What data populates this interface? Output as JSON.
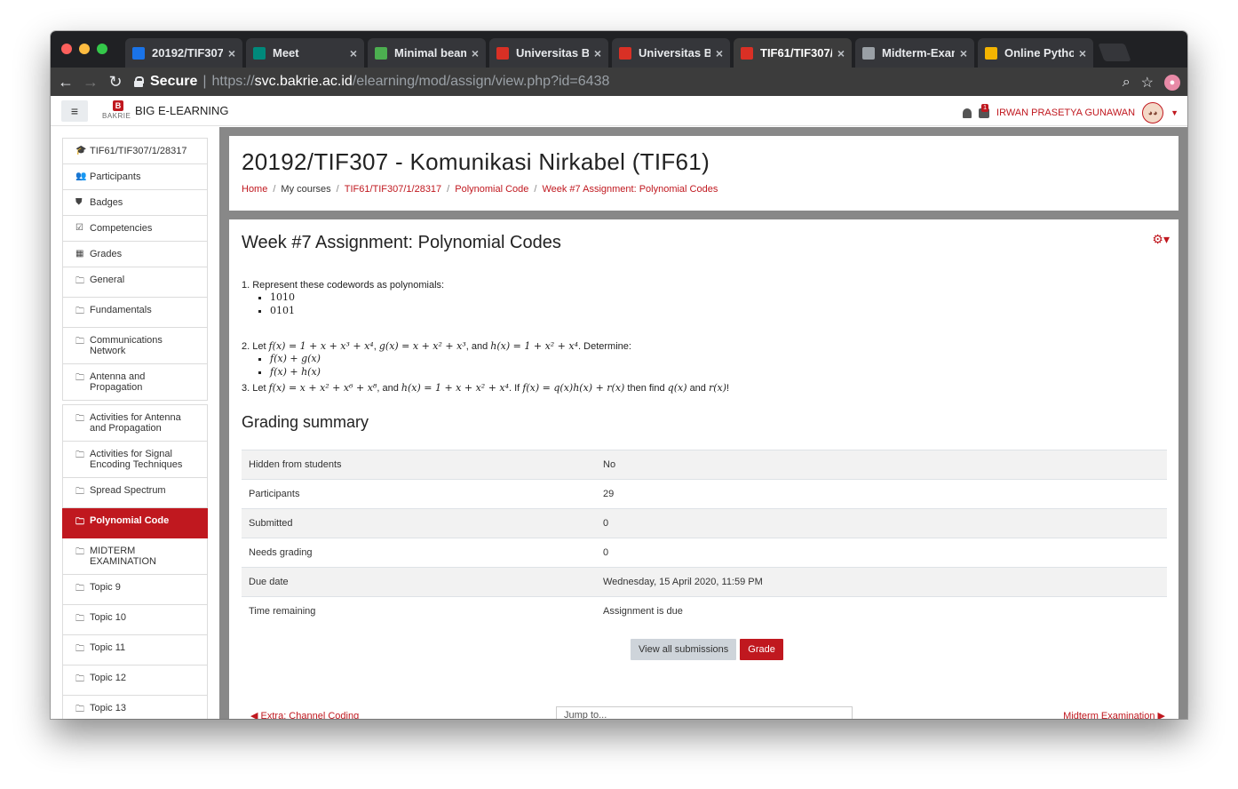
{
  "browser": {
    "tabs": [
      {
        "title": "20192/TIF307",
        "favicon": "moodle-icon",
        "color": "#1a73e8"
      },
      {
        "title": "Meet",
        "favicon": "meet-icon",
        "color": "#00897b"
      },
      {
        "title": "Minimal beam",
        "favicon": "overleaf-icon",
        "color": "#4caf50"
      },
      {
        "title": "Universitas Bak",
        "favicon": "bakrie-icon",
        "color": "#d93025"
      },
      {
        "title": "Universitas Bak",
        "favicon": "bakrie-icon",
        "color": "#d93025"
      },
      {
        "title": "TIF61/TIF307/",
        "favicon": "bakrie-icon",
        "color": "#d93025"
      },
      {
        "title": "Midterm-Exam",
        "favicon": "document-icon",
        "color": "#9aa0a6"
      },
      {
        "title": "Online Python",
        "favicon": "python-icon",
        "color": "#f4b400"
      }
    ],
    "secure_label": "Secure",
    "url_scheme": "https://",
    "url_host": "svc.bakrie.ac.id",
    "url_path": "/elearning/mod/assign/view.php?id=6438"
  },
  "navbar": {
    "logo_text": "BAKRIE",
    "site_name": "BIG E-LEARNING",
    "notification_count": "1",
    "user_name": "IRWAN PRASETYA GUNAWAN"
  },
  "sidebar": {
    "items": [
      {
        "label": "TIF61/TIF307/1/28317",
        "icon": "graduation-cap-icon",
        "glyph": "🎓"
      },
      {
        "label": "Participants",
        "icon": "users-icon",
        "glyph": "👥"
      },
      {
        "label": "Badges",
        "icon": "shield-icon",
        "glyph": "⛊"
      },
      {
        "label": "Competencies",
        "icon": "checkbox-icon",
        "glyph": "☑"
      },
      {
        "label": "Grades",
        "icon": "table-icon",
        "glyph": "▦"
      },
      {
        "label": "General",
        "icon": "folder-icon",
        "glyph": "🗀"
      },
      {
        "label": "Fundamentals",
        "icon": "folder-icon",
        "glyph": "🗀"
      },
      {
        "label": "Communications Network",
        "icon": "folder-icon",
        "glyph": "🗀"
      },
      {
        "label": "Antenna and Propagation",
        "icon": "folder-icon",
        "glyph": "🗀"
      },
      {
        "label": "Activities for Antenna and Propagation",
        "icon": "folder-icon",
        "glyph": "🗀"
      },
      {
        "label": "Activities for Signal Encoding Techniques",
        "icon": "folder-icon",
        "glyph": "🗀"
      },
      {
        "label": "Spread Spectrum",
        "icon": "folder-icon",
        "glyph": "🗀"
      },
      {
        "label": "Polynomial Code",
        "icon": "folder-icon",
        "glyph": "🗀"
      },
      {
        "label": "MIDTERM EXAMINATION",
        "icon": "folder-icon",
        "glyph": "🗀"
      },
      {
        "label": "Topic 9",
        "icon": "folder-icon",
        "glyph": "🗀"
      },
      {
        "label": "Topic 10",
        "icon": "folder-icon",
        "glyph": "🗀"
      },
      {
        "label": "Topic 11",
        "icon": "folder-icon",
        "glyph": "🗀"
      },
      {
        "label": "Topic 12",
        "icon": "folder-icon",
        "glyph": "🗀"
      },
      {
        "label": "Topic 13",
        "icon": "folder-icon",
        "glyph": "🗀"
      }
    ]
  },
  "header": {
    "title": "20192/TIF307 - Komunikasi Nirkabel (TIF61)",
    "breadcrumb": [
      "Home",
      "My courses",
      "TIF61/TIF307/1/28317",
      "Polynomial Code",
      "Week #7 Assignment: Polynomial Codes"
    ]
  },
  "assignment": {
    "title": "Week #7 Assignment: Polynomial Codes",
    "q1": "1. Represent these codewords as polynomials:",
    "q1_items": [
      "1010",
      "0101"
    ],
    "q2_prefix": "2. Let",
    "q2_f": "f(x) = 1 + x + x³ + x⁴",
    "q2_g": "g(x) = x + x² + x³",
    "q2_and": ", and",
    "q2_h": "h(x) = 1 + x² + x⁴",
    "q2_suffix": ". Determine:",
    "q2_items": [
      "f(x) + g(x)",
      "f(x) + h(x)"
    ],
    "q3_prefix": "3. Let",
    "q3_f": "f(x) = x + x² + x⁶ + x⁸",
    "q3_and": ", and",
    "q3_h": "h(x) = 1 + x + x² + x⁴",
    "q3_if": ". If",
    "q3_eq": "f(x) = q(x)h(x) + r(x)",
    "q3_then": "then find",
    "q3_q": "q(x)",
    "q3_and2": "and",
    "q3_r": "r(x)",
    "q3_end": "!"
  },
  "grading": {
    "title": "Grading summary",
    "rows": [
      {
        "label": "Hidden from students",
        "value": "No"
      },
      {
        "label": "Participants",
        "value": "29"
      },
      {
        "label": "Submitted",
        "value": "0"
      },
      {
        "label": "Needs grading",
        "value": "0"
      },
      {
        "label": "Due date",
        "value": "Wednesday, 15 April 2020, 11:59 PM"
      },
      {
        "label": "Time remaining",
        "value": "Assignment is due"
      }
    ],
    "view_all_label": "View all submissions",
    "grade_label": "Grade"
  },
  "footer_nav": {
    "prev": "◀ Extra: Channel Coding",
    "jump": "Jump to...",
    "next": "Midterm Examination ▶"
  },
  "colors": {
    "accent": "#c0181f",
    "tabstrip": "#202124",
    "toolbar": "#3c3c3c"
  }
}
